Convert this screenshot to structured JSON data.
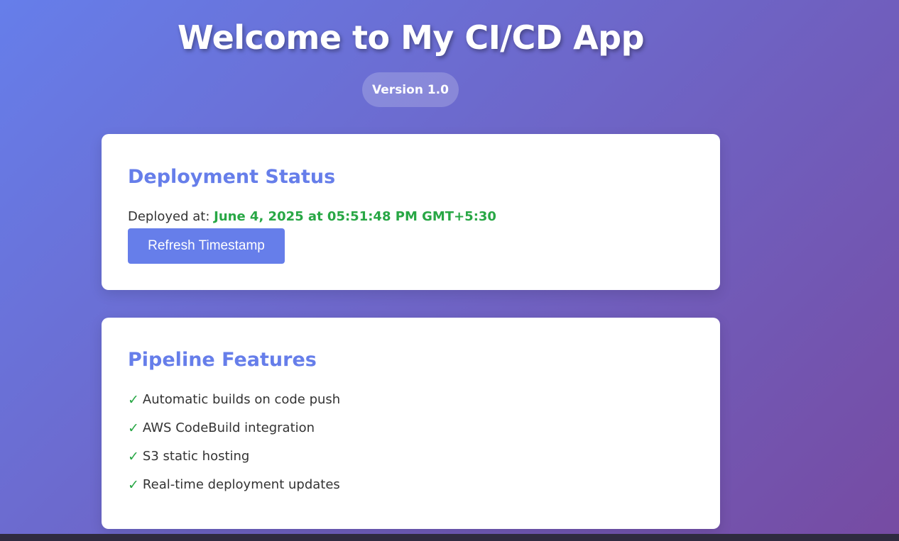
{
  "header": {
    "title": "Welcome to My CI/CD App",
    "version": "Version 1.0"
  },
  "status_card": {
    "heading": "Deployment Status",
    "deployed_label": "Deployed at: ",
    "deployed_value": "June 4, 2025 at 05:51:48 PM GMT+5:30",
    "refresh_button": "Refresh Timestamp"
  },
  "features_card": {
    "heading": "Pipeline Features",
    "check_glyph": "✓",
    "items": [
      "Automatic builds on code push",
      "AWS CodeBuild integration",
      "S3 static hosting",
      "Real-time deployment updates"
    ]
  },
  "colors": {
    "gradient_start": "#667eea",
    "gradient_end": "#764ba2",
    "accent": "#667eea",
    "success": "#28a745",
    "text": "#333333"
  }
}
